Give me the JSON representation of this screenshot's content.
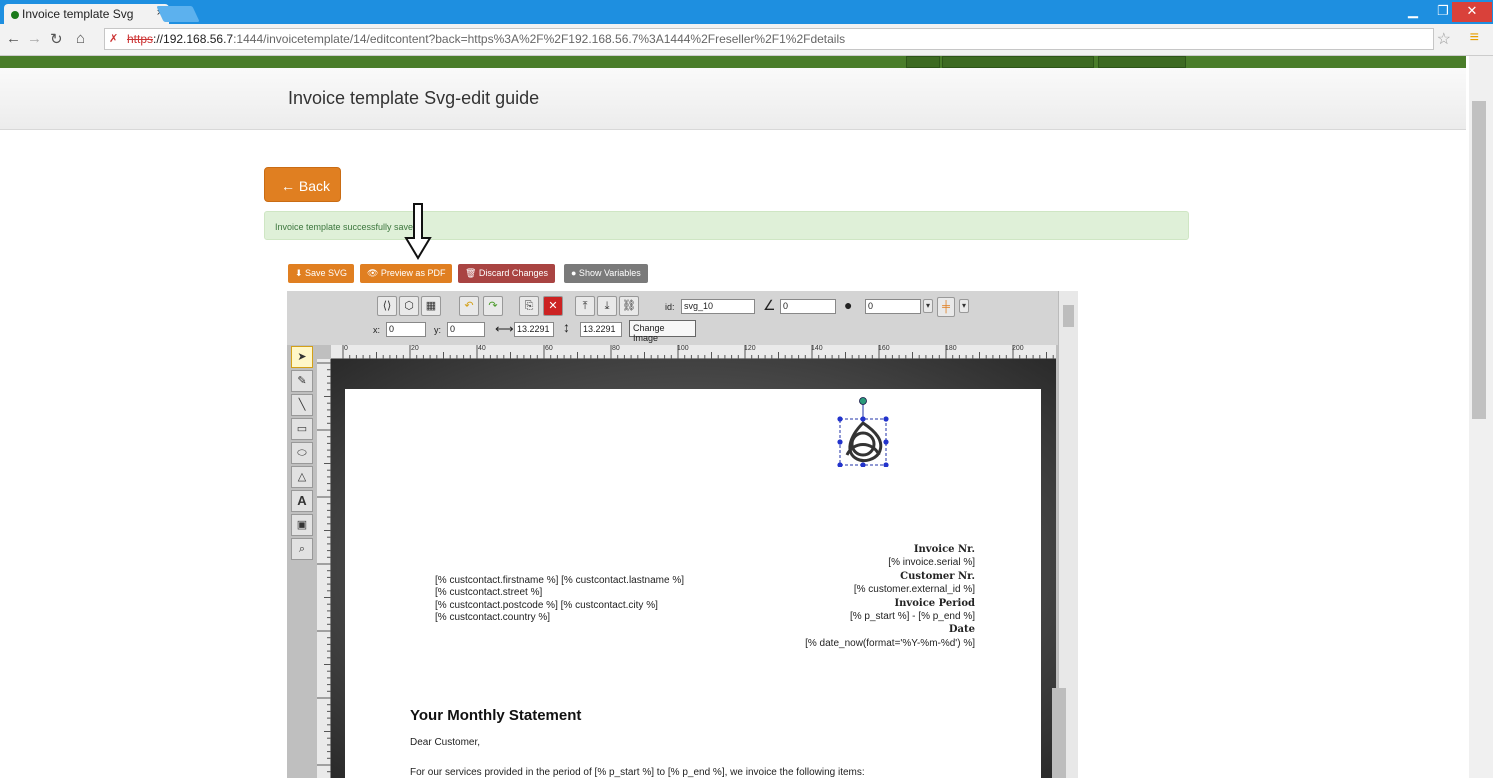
{
  "browser": {
    "tab_title": "Invoice template Svg",
    "tab_close": "×",
    "url_https": "https",
    "url_host": "://192.168.56.7",
    "url_rest": ":1444/invoicetemplate/14/editcontent?back=https%3A%2F%2F192.168.56.7%3A1444%2Freseller%2F1%2Fdetails"
  },
  "page": {
    "title": "Invoice template Svg-edit guide",
    "back_label": "← Back",
    "alert": "Invoice template successfully saved",
    "toolbar": {
      "save_svg": "⬇ Save SVG",
      "preview_pdf": "👁 Preview as PDF",
      "discard": "🗑 Discard Changes",
      "show_variables": "● Show Variables"
    }
  },
  "editor": {
    "id_label": "id:",
    "id_value": "svg_10",
    "angle_value": "0",
    "blur_value": "0",
    "x_label": "x:",
    "x_value": "0",
    "y_label": "y:",
    "y_value": "0",
    "width_value": "13.2291",
    "height_value": "13.2291",
    "tooltip": "Change Image",
    "ruler_h": [
      "0",
      "20",
      "40",
      "60",
      "80",
      "100",
      "120",
      "140",
      "160",
      "180",
      "200"
    ]
  },
  "document": {
    "address": [
      "[% custcontact.firstname %] [% custcontact.lastname %]",
      "[% custcontact.street %]",
      "[% custcontact.postcode %] [% custcontact.city %]",
      "[% custcontact.country %]"
    ],
    "invoice_nr_label": "Invoice Nr.",
    "invoice_nr_value": "[% invoice.serial %]",
    "customer_nr_label": "Customer Nr.",
    "customer_nr_value": "[% customer.external_id %]",
    "period_label": "Invoice Period",
    "period_value": "[% p_start %] - [% p_end %]",
    "date_label": "Date",
    "date_value": "[% date_now(format='%Y-%m-%d') %]",
    "statement_title": "Your Monthly Statement",
    "greeting": "Dear Customer,",
    "intro": "For our services provided in the period of [% p_start %] to [% p_end %], we invoice the following items:"
  },
  "colors": {
    "orange": "#e07f21",
    "dark_red": "#a94442",
    "gray": "#7a7a7a",
    "green_bar": "#4a7d2a",
    "browser_blue": "#1e8fe0"
  }
}
